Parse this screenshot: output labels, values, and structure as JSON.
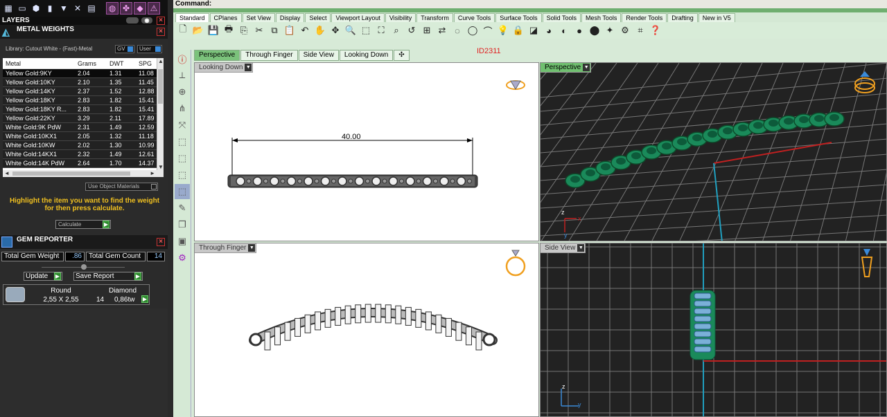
{
  "left_panel": {
    "top_icons": [
      "grid-icon",
      "window-icon",
      "cube-icon",
      "book-icon",
      "filter-icon",
      "transform-icon",
      "layers-icon",
      "ring-icon",
      "tools-icon",
      "gem-icon",
      "warning-icon"
    ],
    "layers_title": "LAYERS",
    "metal_weights": {
      "title": "METAL WEIGHTS",
      "library_label": "Library: Cutout White - (Fast)-Metal",
      "gv_label": "GV",
      "user_label": "User",
      "columns": [
        "Metal",
        "Grams",
        "DWT",
        "SPG"
      ],
      "rows": [
        [
          "Yellow Gold:9KY",
          "2.04",
          "1.31",
          "11.08"
        ],
        [
          "Yellow Gold:10KY",
          "2.10",
          "1.35",
          "11.45"
        ],
        [
          "Yellow Gold:14KY",
          "2.37",
          "1.52",
          "12.88"
        ],
        [
          "Yellow Gold:18KY",
          "2.83",
          "1.82",
          "15.41"
        ],
        [
          "Yellow Gold:18KY R...",
          "2.83",
          "1.82",
          "15.41"
        ],
        [
          "Yellow Gold:22KY",
          "3.29",
          "2.11",
          "17.89"
        ],
        [
          "White Gold:9K PdW",
          "2.31",
          "1.49",
          "12.59"
        ],
        [
          "White Gold:10KX1",
          "2.05",
          "1.32",
          "11.18"
        ],
        [
          "White Gold:10KW",
          "2.02",
          "1.30",
          "10.99"
        ],
        [
          "White Gold:14KX1",
          "2.32",
          "1.49",
          "12.61"
        ],
        [
          "White Gold:14K PdW",
          "2.64",
          "1.70",
          "14.37"
        ]
      ],
      "use_object_materials": "Use Object Materials",
      "hint": "Highlight the item you want to find the weight for then press calculate.",
      "calculate": "Calculate"
    },
    "gem_reporter": {
      "title": "GEM REPORTER",
      "total_weight_label": "Total Gem Weight",
      "total_weight_value": ".86",
      "total_count_label": "Total Gem Count",
      "total_count_value": "14",
      "update_label": "Update",
      "save_report_label": "Save Report",
      "gem_shape": "Round",
      "gem_type": "Diamond",
      "gem_size": "2,55 X 2,55",
      "gem_count": "14",
      "gem_weight": "0,86tw"
    }
  },
  "main": {
    "command_label": "Command:",
    "tabs": [
      "Standard",
      "CPlanes",
      "Set View",
      "Display",
      "Select",
      "Viewport Layout",
      "Visibility",
      "Transform",
      "Curve Tools",
      "Surface Tools",
      "Solid Tools",
      "Mesh Tools",
      "Render Tools",
      "Drafting",
      "New in V5"
    ],
    "viewport_tabs": [
      "Perspective",
      "Through Finger",
      "Side View",
      "Looking Down"
    ],
    "id_label": "ID2311",
    "viewports": {
      "looking_down": "Looking Down",
      "perspective": "Perspective",
      "through_finger": "Through Finger",
      "side_view": "Side View"
    },
    "dimension": "40.00",
    "axis_x": "x",
    "axis_y": "y",
    "axis_z": "z"
  }
}
